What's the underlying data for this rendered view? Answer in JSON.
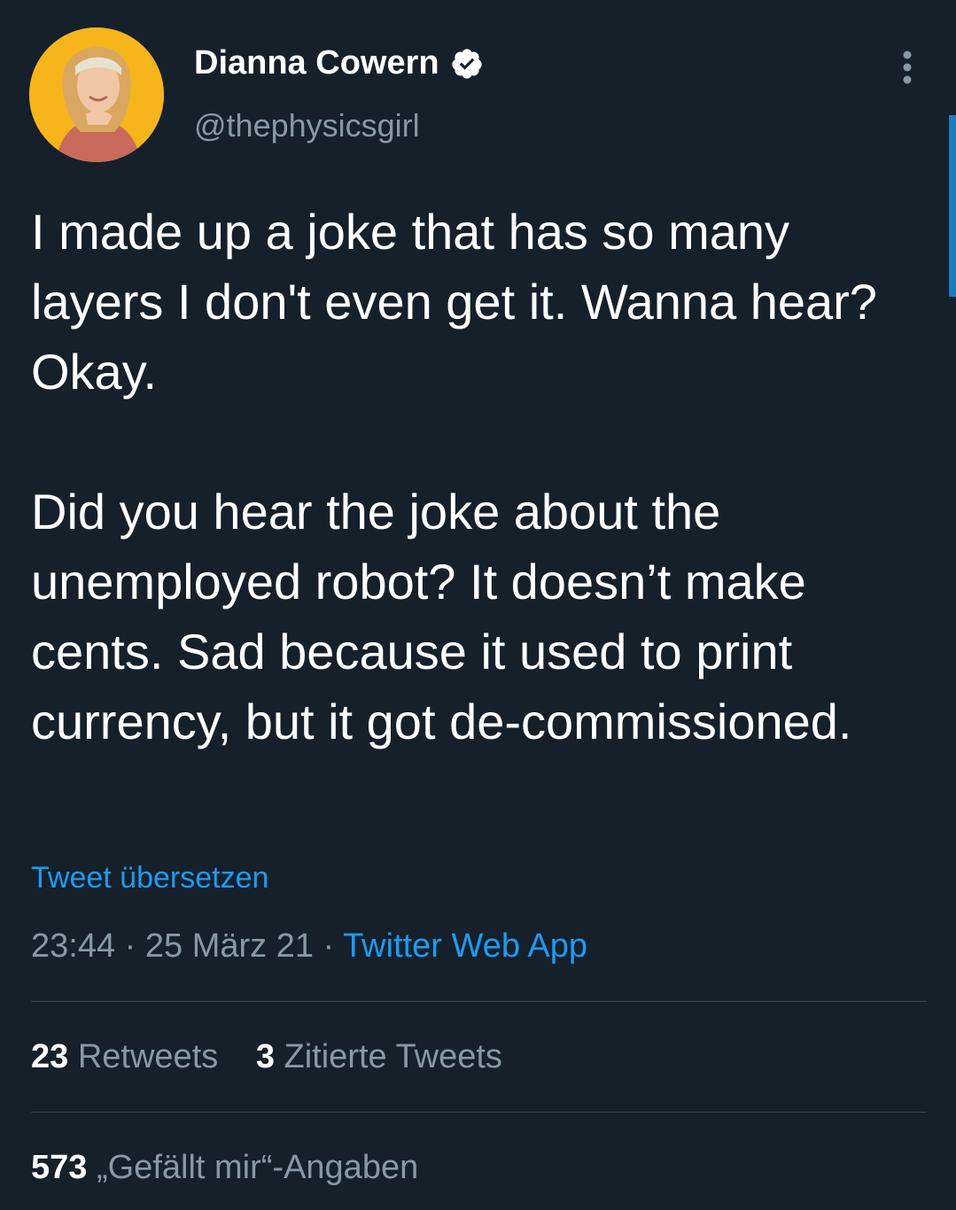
{
  "author": {
    "display_name": "Dianna Cowern",
    "handle": "@thephysicsgirl",
    "verified": true,
    "avatar_icon": "profile-photo",
    "verified_icon": "verified-badge-icon"
  },
  "tweet": {
    "paragraphs": [
      "I made up a joke that has so many layers I don't even get it. Wanna hear? Okay.",
      "Did you hear the joke about the unemployed robot? It doesn’t make cents. Sad because it used to print currency, but it got de-commissioned."
    ],
    "translate_label": "Tweet übersetzen",
    "time": "23:44",
    "date": "25 März 21",
    "separator": "·",
    "source": "Twitter Web App"
  },
  "stats": {
    "retweets_count": "23",
    "retweets_label": "Retweets",
    "quotes_count": "3",
    "quotes_label": "Zitierte Tweets",
    "likes_count": "573",
    "likes_label": "„Gefällt mir“-Angaben"
  },
  "colors": {
    "background": "#15202b",
    "text": "#ffffff",
    "secondary_text": "#8899a6",
    "accent": "#1d9bf0",
    "divider": "#38444d",
    "avatar_bg": "#f5b51b"
  }
}
